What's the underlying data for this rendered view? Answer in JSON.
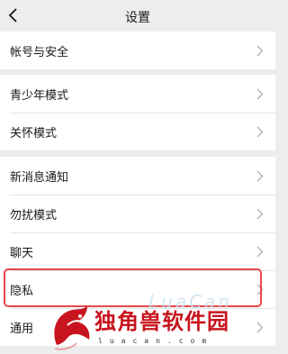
{
  "nav": {
    "title": "设置",
    "back_icon": "chevron-left-icon"
  },
  "groups": [
    {
      "items": [
        {
          "label": "帐号与安全"
        }
      ]
    },
    {
      "items": [
        {
          "label": "青少年模式"
        },
        {
          "label": "关怀模式"
        }
      ]
    },
    {
      "items": [
        {
          "label": "新消息通知"
        },
        {
          "label": "勿扰模式"
        },
        {
          "label": "聊天"
        },
        {
          "label": "隐私"
        },
        {
          "label": "通用"
        }
      ]
    }
  ],
  "highlighted_item": "隐私",
  "watermark": {
    "name": "独角兽软件园",
    "url": "luacan.com",
    "ghost_text": "LuaCan"
  },
  "colors": {
    "background": "#ededed",
    "card": "#ffffff",
    "highlight": "#e8484a",
    "watermark_red": "#c8141e"
  }
}
